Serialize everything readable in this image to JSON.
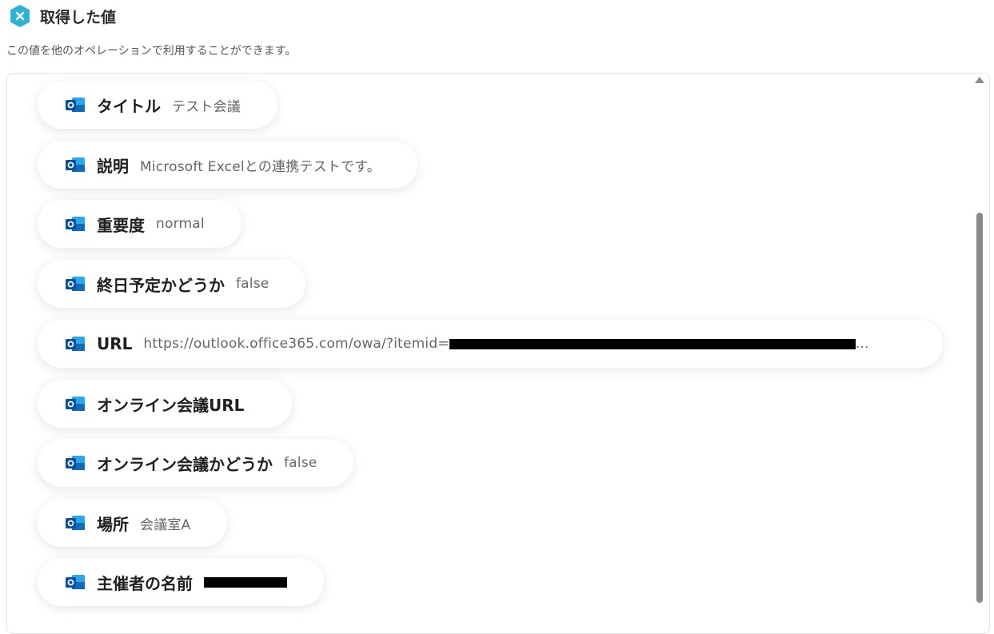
{
  "header": {
    "title": "取得した値",
    "subtitle": "この値を他のオペレーションで利用することができます。"
  },
  "items": [
    {
      "label": "タイトル",
      "value": "テスト会議"
    },
    {
      "label": "説明",
      "value": "Microsoft Excelとの連携テストです。"
    },
    {
      "label": "重要度",
      "value": "normal"
    },
    {
      "label": "終日予定かどうか",
      "value": "false"
    },
    {
      "label": "URL",
      "value": "https://outlook.office365.com/owa/?itemid=",
      "suffix": "..."
    },
    {
      "label": "オンライン会議URL",
      "value": ""
    },
    {
      "label": "オンライン会議かどうか",
      "value": "false"
    },
    {
      "label": "場所",
      "value": "会議室A"
    },
    {
      "label": "主催者の名前",
      "value": ""
    }
  ],
  "colors": {
    "accent": "#2bb3d6",
    "outlook_blue": "#0f6cbd"
  },
  "icons": {
    "header": "x-close-hexagon-icon",
    "item": "outlook-icon"
  }
}
